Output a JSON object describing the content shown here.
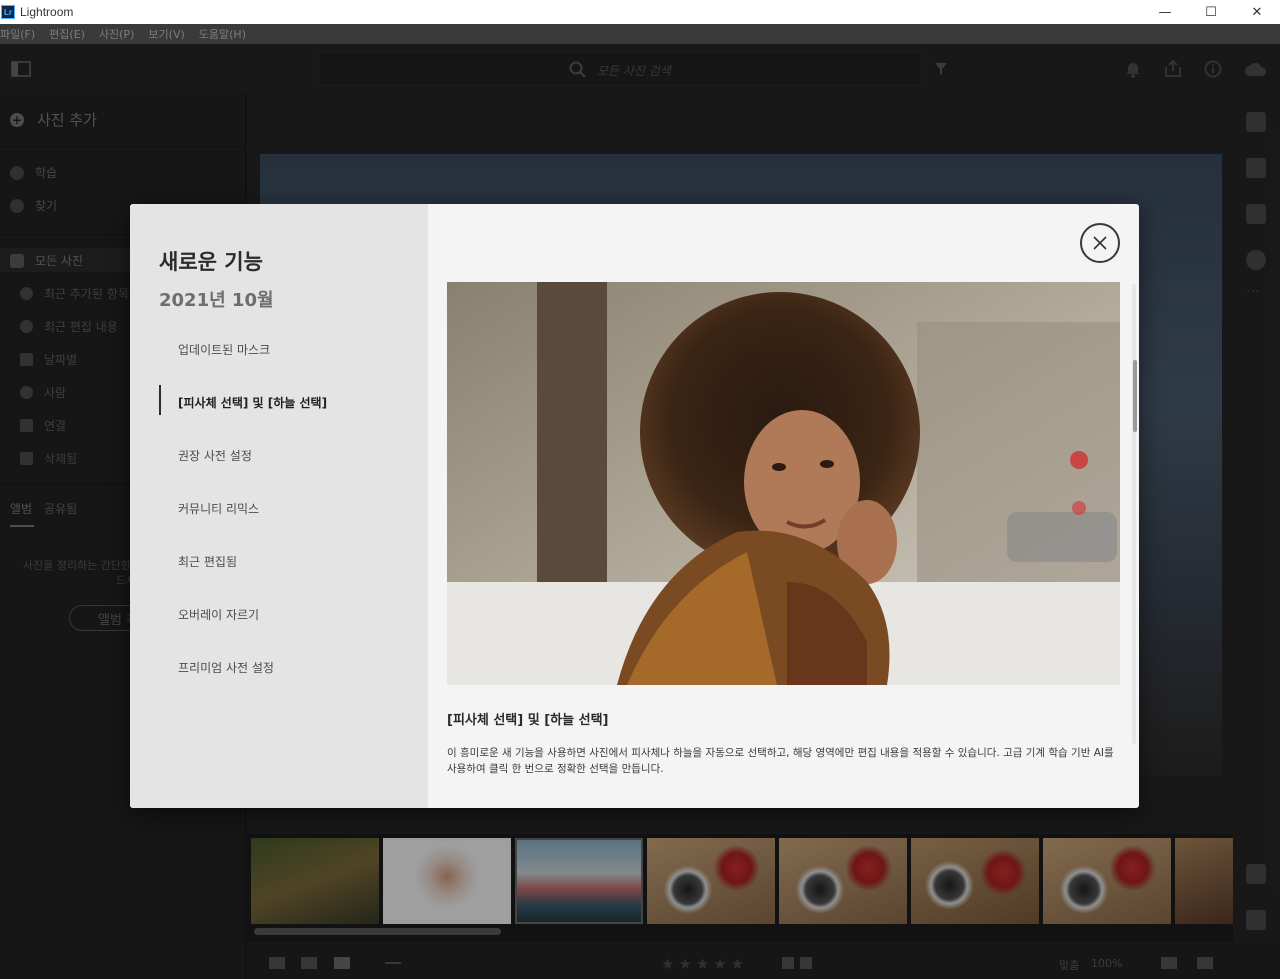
{
  "window": {
    "app_icon": "Lr",
    "title": "Lightroom",
    "minimize": "—",
    "maximize": "☐",
    "close": "✕"
  },
  "menu": [
    "파일(F)",
    "편집(E)",
    "사진(P)",
    "보기(V)",
    "도움말(H)"
  ],
  "toolbar": {
    "search_placeholder": "모든 사진 검색"
  },
  "left_panel": {
    "add_photos": "사진 추가",
    "learn": "학습",
    "discover": "찾기",
    "all_photos": "모든 사진",
    "sub_items": [
      "최근 추가된 항목",
      "최근 편집 내용",
      "날짜별",
      "사람",
      "연결",
      "삭제됨"
    ],
    "tabs": [
      "앨범",
      "공유됨"
    ],
    "help_text": "사진을 정리하는 간단한 방법, 첫 번째 앨범을 만드세요.",
    "album_button": "앨범 추가"
  },
  "bottom_bar": {
    "zoom_label": "맞춤",
    "zoom_value": "100%",
    "stars": "★★★★★"
  },
  "modal": {
    "title": "새로운 기능",
    "date": "2021년 10월",
    "nav_items": [
      "업데이트된 마스크",
      "[피사체 선택] 및 [하늘 선택]",
      "권장 사전 설정",
      "커뮤니티 리믹스",
      "최근 편집됨",
      "오버레이 자르기",
      "프리미엄 사전 설정"
    ],
    "active_index": 1,
    "feature_heading": "[피사체 선택] 및 [하늘 선택]",
    "feature_description": "이 흥미로운 새 기능을 사용하면 사진에서 피사체나 하늘을 자동으로 선택하고, 해당 영역에만 편집 내용을 적용할 수 있습니다. 고급 기계 학습 기반 AI를 사용하여 클릭 한 번으로 정확한 선택을 만듭니다."
  }
}
